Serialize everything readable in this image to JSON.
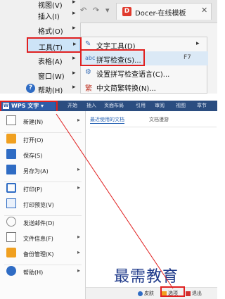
{
  "top": {
    "menu_items": [
      {
        "label": "视图(V)",
        "arrow": "▸"
      },
      {
        "label": "插入(I)",
        "arrow": "▸"
      },
      {
        "label": "格式(O)",
        "arrow": "▸"
      },
      {
        "label": "工具(T)",
        "arrow": "▸",
        "selected": true
      },
      {
        "label": "表格(A)",
        "arrow": "▸"
      },
      {
        "label": "窗口(W)",
        "arrow": "▸"
      },
      {
        "label": "帮助(H)",
        "arrow": "▸",
        "icon": "help-icon"
      }
    ],
    "tab_nav": {
      "back": "↶",
      "forward": "↷",
      "dropdown": "▾"
    },
    "docer_tab": {
      "icon_letter": "D",
      "title": "Docer-在线模板",
      "close": "✕"
    },
    "submenu": [
      {
        "icon": "text-tool-icon",
        "glyph": "✎",
        "label": "文字工具(D)",
        "arrow": "▸"
      },
      {
        "icon": "spell-check-icon",
        "glyph": "abc",
        "label": "拼写检查(S)...",
        "shortcut": "F7",
        "highlighted": true
      },
      {
        "icon": "spell-language-icon",
        "glyph": "⚙",
        "label": "设置拼写检查语言(C)..."
      },
      {
        "icon": "convert-chinese-icon",
        "glyph": "繁",
        "label": "中文简繁转换(N)..."
      }
    ]
  },
  "bottom": {
    "app_button": {
      "icon_letter": "W",
      "label": "WPS 文字",
      "arrow": "▾"
    },
    "ribbon_tabs": [
      "开始",
      "插入",
      "页面布局",
      "引用",
      "审阅",
      "视图",
      "章节"
    ],
    "app_menu": [
      {
        "label": "新建(N)",
        "icon": "new-doc-icon",
        "arrow": "▸"
      },
      {
        "label": "打开(O)",
        "icon": "open-folder-icon"
      },
      {
        "label": "保存(S)",
        "icon": "save-icon"
      },
      {
        "label": "另存为(A)",
        "icon": "save-as-icon",
        "arrow": "▸"
      },
      {
        "label": "打印(P)",
        "icon": "print-icon",
        "arrow": "▸"
      },
      {
        "label": "打印预览(V)",
        "icon": "print-preview-icon"
      },
      {
        "label": "发送邮件(D)",
        "icon": "mail-icon"
      },
      {
        "label": "文件信息(F)",
        "icon": "file-info-icon",
        "arrow": "▸"
      },
      {
        "label": "备份管理(K)",
        "icon": "backup-icon",
        "arrow": "▸"
      },
      {
        "label": "帮助(H)",
        "icon": "help-icon",
        "arrow": "▸"
      }
    ],
    "recent_tabs": {
      "active": "最近使用的文档",
      "other": "文档漫游"
    },
    "status": {
      "help_label": "皮肤",
      "options_label": "选项",
      "exit_label": "退出"
    },
    "watermark": "最需教育"
  },
  "colors": {
    "accent_red": "#e02020",
    "ribbon_blue": "#2b4d80",
    "selection": "#cde4f7"
  }
}
